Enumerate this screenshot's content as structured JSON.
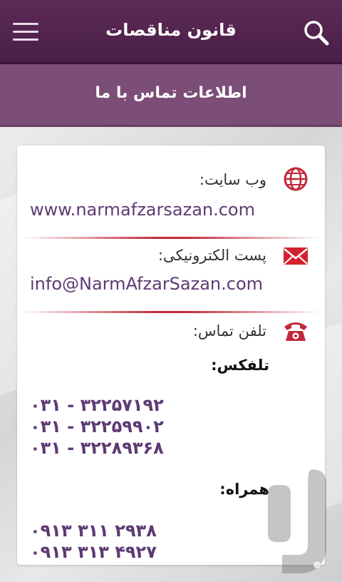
{
  "header": {
    "app_title": "قانون مناقصات"
  },
  "subheader": {
    "title": "اطلاعات تماس با ما"
  },
  "contact": {
    "website_label": "وب سایت:",
    "website_value": "www.narmafzarsazan.com",
    "email_label": "پست الکترونیکی:",
    "email_value": "info@NarmAfzarSazan.com",
    "phone_label": "تلفن تماس:",
    "telefax_heading": "تلفکس:",
    "telefax_numbers": [
      "۰۳۱ - ۳۲۲۵۷۱۹۲",
      "۰۳۱ - ۳۲۲۵۹۹۰۲",
      "۰۳۱ - ۳۲۲۸۹۳۶۸"
    ],
    "mobile_heading": "همراه:",
    "mobile_numbers": [
      "۰۹۱۳ ۳۱۱ ۲۹۳۸",
      "۰۹۱۳ ۳۱۳ ۴۹۲۷"
    ]
  },
  "icons": {
    "menu": "hamburger-menu-icon",
    "search": "magnifier-icon",
    "website": "globe-icon",
    "email": "envelope-icon",
    "phone": "telephone-icon",
    "watermark": "store-logo-icon"
  },
  "colors": {
    "topbar": "#4a1f46",
    "subbar": "#7b4d77",
    "accent_red": "#c12a3a",
    "value_text": "#5e3a74"
  }
}
